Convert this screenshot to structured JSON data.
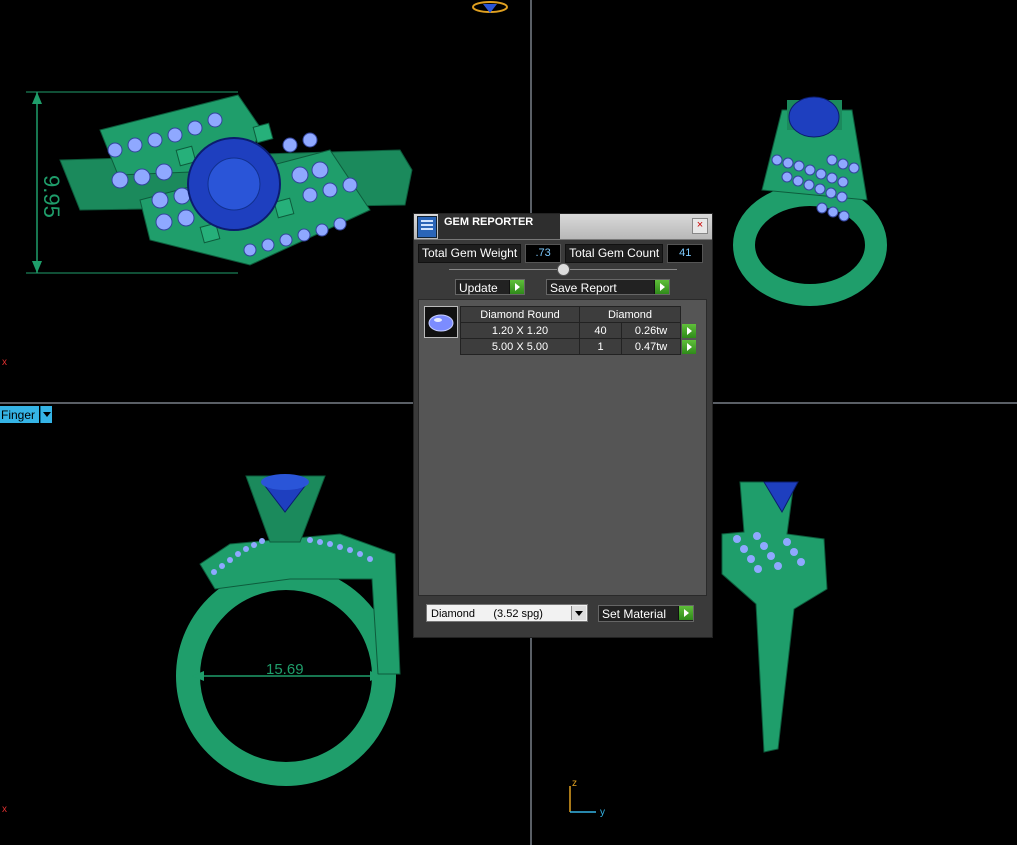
{
  "viewports": {
    "top_left": {
      "dimension": "9.95",
      "axis": "x"
    },
    "bottom_left": {
      "label": "Finger",
      "dimension": "15.69",
      "axis": "x"
    },
    "bottom_right": {
      "axis_z": "z",
      "axis_y": "y"
    }
  },
  "gem_reporter": {
    "title": "GEM REPORTER",
    "close": "×",
    "total_weight_label": "Total Gem Weight",
    "total_weight_value": ".73",
    "total_count_label": "Total Gem Count",
    "total_count_value": "41",
    "update_label": "Update",
    "save_label": "Save Report",
    "table": {
      "col1": "Diamond Round",
      "col2": "Diamond",
      "rows": [
        {
          "size": "1.20 X 1.20",
          "count": "40",
          "weight": "0.26tw"
        },
        {
          "size": "5.00 X 5.00",
          "count": "1",
          "weight": "0.47tw"
        }
      ]
    },
    "material_value": "Diamond      (3.52 spg)",
    "set_material_label": "Set Material"
  },
  "colors": {
    "metal": "#1f9e6b",
    "stone": "#1e3fbf",
    "small_stones": "#8fa8ff",
    "panel_bg": "#3a3a3a"
  },
  "icons": [
    "gem-reporter-icon",
    "close-icon",
    "play-icon",
    "dropdown-arrow-icon",
    "gem-thumbnail-icon"
  ]
}
